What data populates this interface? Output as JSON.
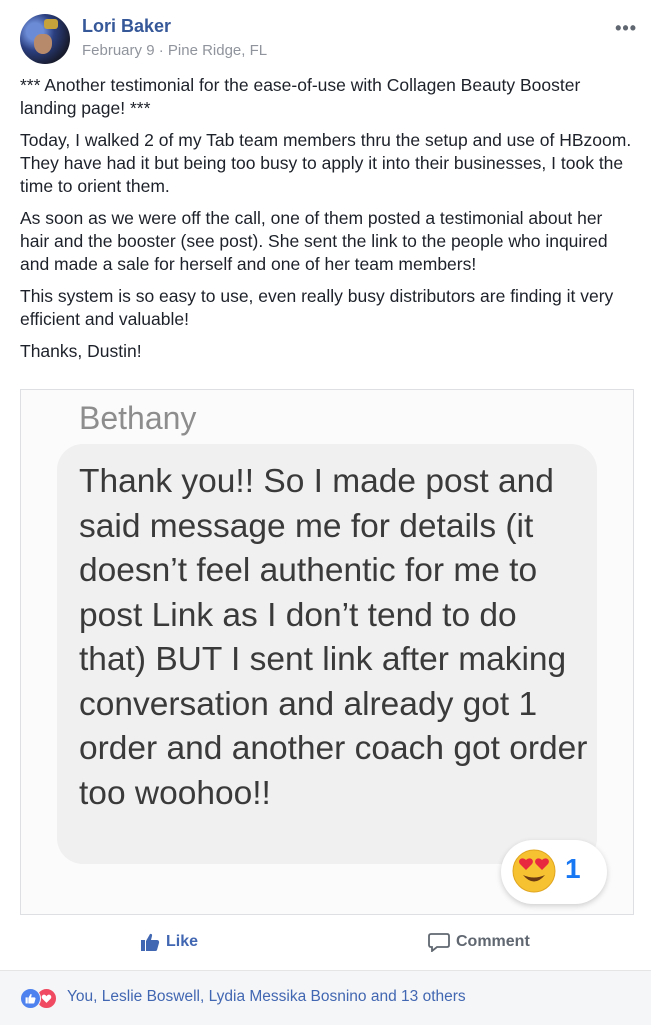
{
  "post": {
    "author": "Lori Baker",
    "date": "February 9",
    "separator": "·",
    "location": "Pine Ridge, FL",
    "more_icon": "more-horizontal-icon",
    "text": [
      "*** Another testimonial for the ease-of-use with Collagen Beauty Booster landing page! ***",
      "Today, I walked 2 of my Tab team members thru the setup and use of HBzoom. They have had it but being too busy to apply it into their businesses, I took the time to orient them.",
      "As soon as we were off the call, one of them posted a testimonial about her hair and the booster (see post). She sent the link to the people who inquired and made a sale for herself and one of her team members!",
      "This system is so easy to use, even really busy distributors are finding it very efficient and valuable!",
      "Thanks, Dustin!"
    ]
  },
  "image": {
    "sender": "Bethany",
    "message": "Thank you!!  So I made post and said message me for details (it doesn’t feel authentic for me to post Link as I don’t tend to do that) BUT I sent link after making conversation and already got 1 order and another coach got order too woohoo!!",
    "reaction_icon": "heart-eyes-emoji",
    "reaction_count": "1"
  },
  "actions": {
    "like_label": "Like",
    "comment_label": "Comment"
  },
  "reactions": {
    "icons": [
      "like-reaction-icon",
      "love-reaction-icon"
    ],
    "text": "You, Leslie Boswell, Lydia Messika Bosnino and 13 others"
  },
  "colors": {
    "link_blue": "#365899",
    "like_blue": "#4267b2",
    "meta_gray": "#90949c"
  }
}
